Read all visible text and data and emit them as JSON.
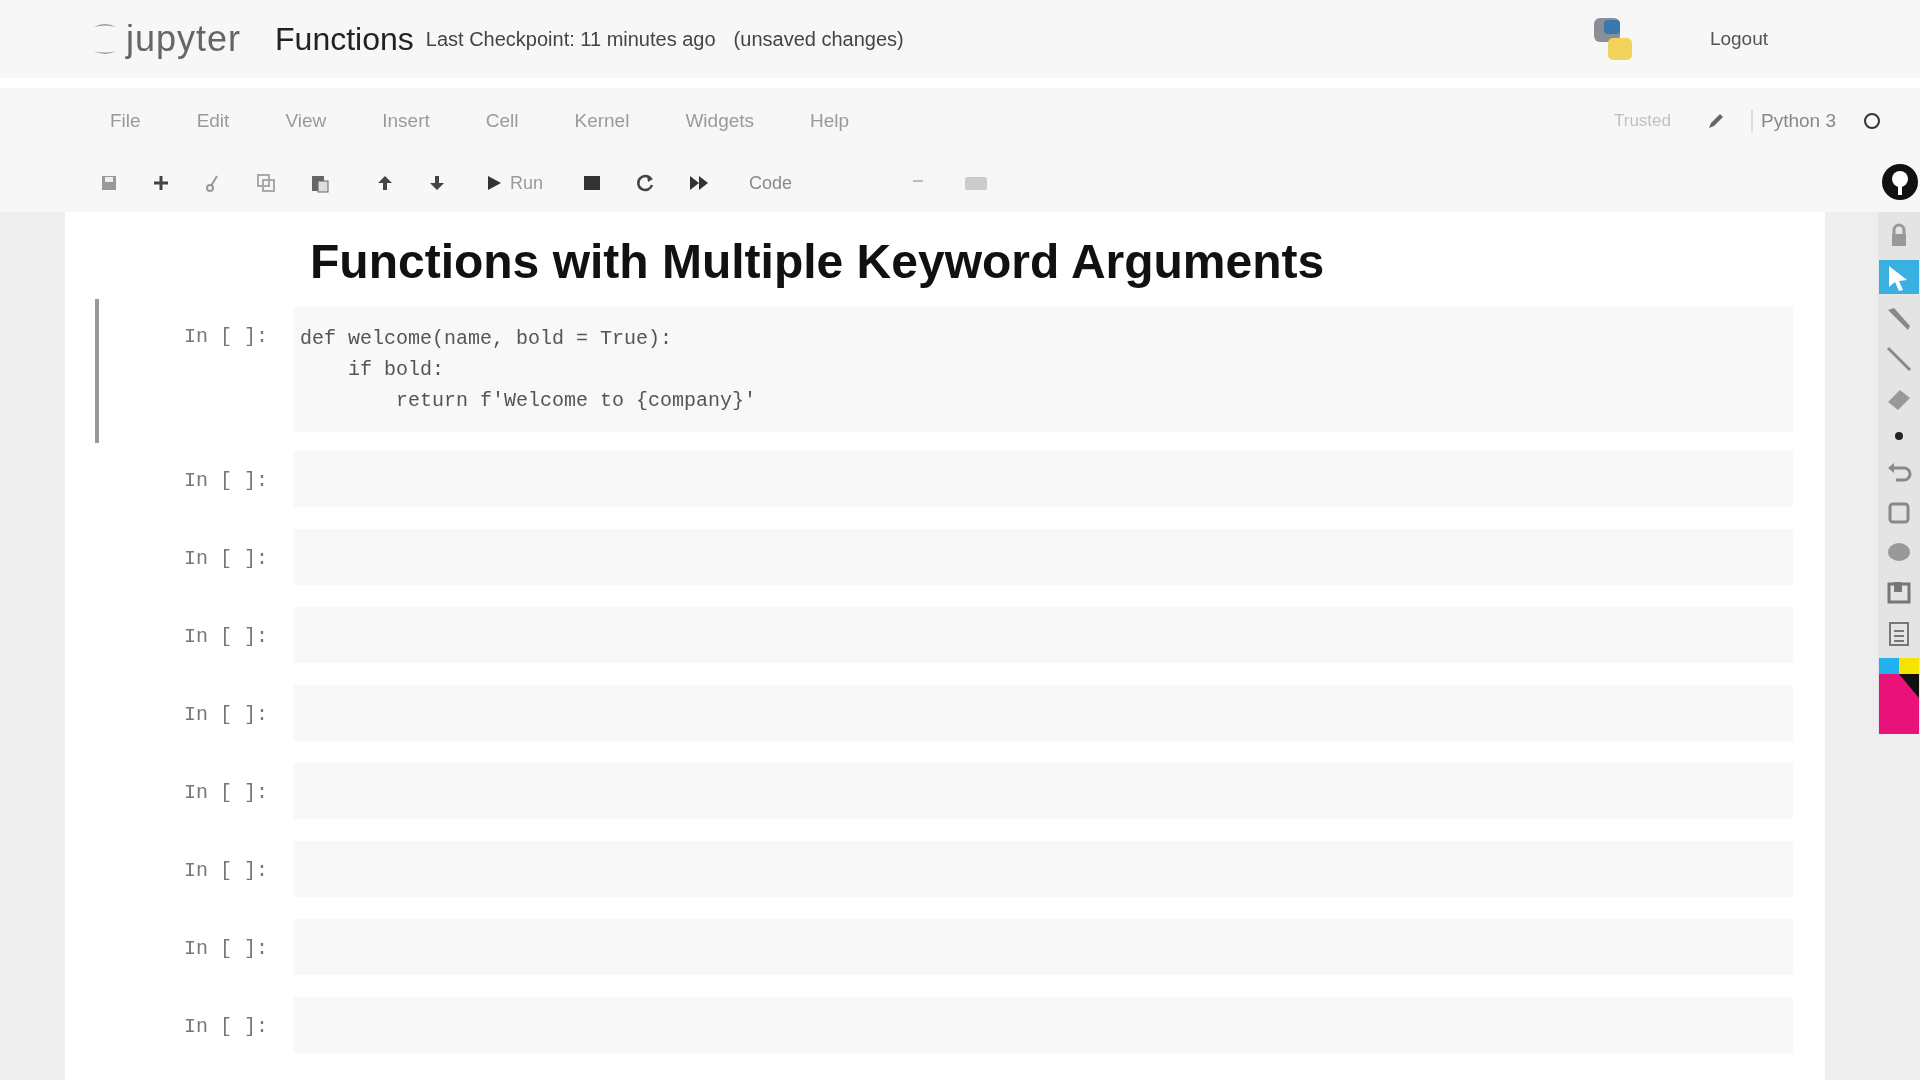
{
  "header": {
    "logo_text": "jupyter",
    "title": "Functions",
    "checkpoint": "Last Checkpoint: 11 minutes ago",
    "unsaved": "(unsaved changes)",
    "logout": "Logout"
  },
  "menus": [
    "File",
    "Edit",
    "View",
    "Insert",
    "Cell",
    "Kernel",
    "Widgets",
    "Help"
  ],
  "kernel": {
    "trusted": "Trusted",
    "name": "Python 3"
  },
  "toolbar": {
    "run_label": "Run",
    "cell_type": "Code"
  },
  "notebook": {
    "heading": "Functions with Multiple Keyword Arguments",
    "cells": [
      {
        "prompt": "In [ ]:",
        "selected": true,
        "lines": [
          "def welcome(name, bold = True):",
          "    if bold:",
          "        return f'Welcome to {company}'"
        ]
      },
      {
        "prompt": "In [ ]:",
        "selected": false
      },
      {
        "prompt": "In [ ]:",
        "selected": false
      },
      {
        "prompt": "In [ ]:",
        "selected": false
      },
      {
        "prompt": "In [ ]:",
        "selected": false
      },
      {
        "prompt": "In [ ]:",
        "selected": false
      },
      {
        "prompt": "In [ ]:",
        "selected": false
      },
      {
        "prompt": "In [ ]:",
        "selected": false
      },
      {
        "prompt": "In [ ]:",
        "selected": false
      }
    ]
  }
}
